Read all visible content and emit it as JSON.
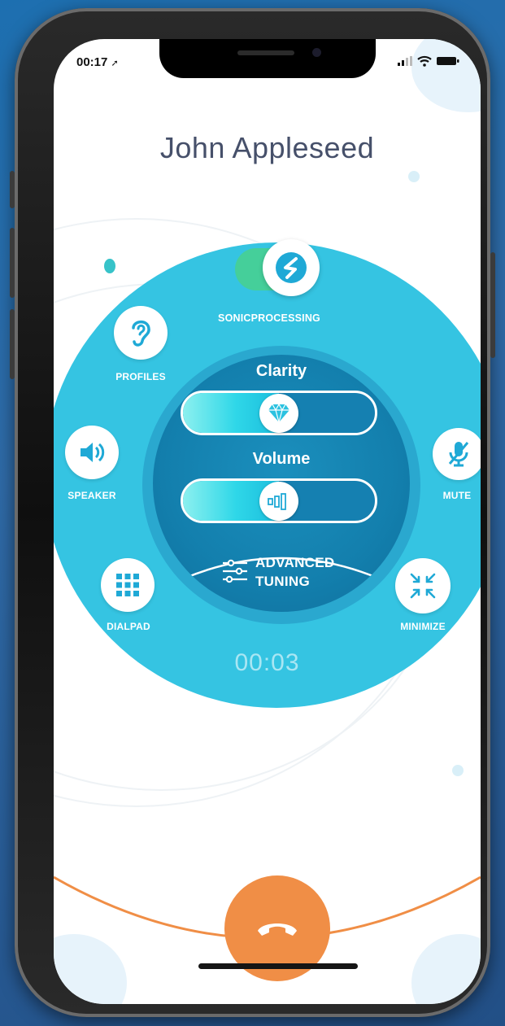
{
  "status_bar": {
    "time": "00:17"
  },
  "call": {
    "caller_name": "John Appleseed",
    "timer": "00:03"
  },
  "controls": {
    "sonic_processing": {
      "label": "SONICPROCESSING",
      "enabled": true
    },
    "profiles_label": "PROFILES",
    "speaker_label": "SPEAKER",
    "mute_label": "MUTE",
    "dialpad_label": "DIALPAD",
    "minimize_label": "MINIMIZE"
  },
  "sliders": {
    "clarity": {
      "label": "Clarity",
      "level": 0.5
    },
    "volume": {
      "label": "Volume",
      "level": 0.5
    }
  },
  "advanced": {
    "line1": "ADVANCED",
    "line2": "TUNING"
  },
  "colors": {
    "accent_cyan": "#35c4e2",
    "inner_blue": "#137fad",
    "toggle_green": "#45cf9a",
    "hangup_orange": "#f08e46"
  }
}
